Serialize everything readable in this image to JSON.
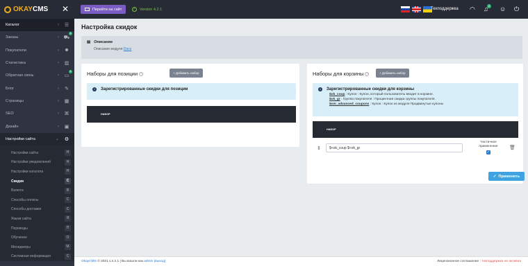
{
  "topbar": {
    "logo_ok": "OKAY",
    "logo_cms": "CMS",
    "goto_site": "Перейти на сайт",
    "version": "Version 4.2.1",
    "support": "Техподдержка",
    "notif_count": "2",
    "sidebar_badge": "4"
  },
  "sidebar": {
    "items": [
      {
        "label": "Каталог",
        "icon": "list-icon"
      },
      {
        "label": "Заказы",
        "icon": "cart-icon",
        "badge": "4"
      },
      {
        "label": "Покупатели",
        "icon": "users-icon"
      },
      {
        "label": "Статистика",
        "icon": "chart-icon"
      },
      {
        "label": "Обратная связь",
        "icon": "comments-icon",
        "badge": "4"
      },
      {
        "label": "Блог",
        "icon": "pencil-icon"
      },
      {
        "label": "Страницы",
        "icon": "calendar-icon"
      },
      {
        "label": "SEO",
        "icon": "seo-icon"
      },
      {
        "label": "Дизайн",
        "icon": "design-icon"
      },
      {
        "label": "Настройки сайта",
        "icon": "gear-icon"
      }
    ],
    "sub_items": [
      {
        "label": "Настройки сайта",
        "key": "Н"
      },
      {
        "label": "Настройки уведомлений",
        "key": "Н"
      },
      {
        "label": "Настройки каталога",
        "key": "Н"
      },
      {
        "label": "Скидки",
        "key": "С"
      },
      {
        "label": "Валюта",
        "key": "В"
      },
      {
        "label": "Способы оплаты",
        "key": "С"
      },
      {
        "label": "Способы доставки",
        "key": "С"
      },
      {
        "label": "Языки сайта",
        "key": "Я"
      },
      {
        "label": "Переводы",
        "key": "П"
      },
      {
        "label": "Обучение",
        "key": "О"
      },
      {
        "label": "Менеджеры",
        "key": "М"
      },
      {
        "label": "Системная информация",
        "key": "С"
      }
    ]
  },
  "main": {
    "title": "Настройка скидок",
    "description": {
      "title": "Описание",
      "text": "Описание модуля",
      "link": "Docs"
    },
    "left_panel": {
      "title": "Наборы для позиции",
      "add_button": "+ Добавить набор",
      "info_title": "Зарегистрированные скидки для позиции",
      "table_header": "НАБОР"
    },
    "right_panel": {
      "title": "Наборы для корзины",
      "add_button": "+ Добавить набор",
      "info_title": "Зарегистрированные скидки для корзины",
      "info_lines": [
        {
          "code": "$ok_coup",
          "text": " : Купон : Купон, который пользователь вводит в корзине."
        },
        {
          "code": "$ok_gr",
          "text": " : Группа покупателя : Процентная скидка группы покупателя."
        },
        {
          "code": "$om_advanced_coupons",
          "text": " : Купон : Купон из модуля Продвинутые купоны"
        }
      ],
      "table_header": "НАБОР",
      "row_value": "$<ok_coup $<ok_gr",
      "partial_label_1": "Частичное",
      "partial_label_2": "применение"
    },
    "apply_button": "Применить"
  },
  "footer": {
    "brand": "OkayCMS",
    "copyright": "© 2021 v.4.2.1 | Вы вошли как",
    "user": "admin",
    "logout": "(выход)",
    "license": "Лицензионное соглашение :",
    "license_status": "техподдержка не активна"
  }
}
